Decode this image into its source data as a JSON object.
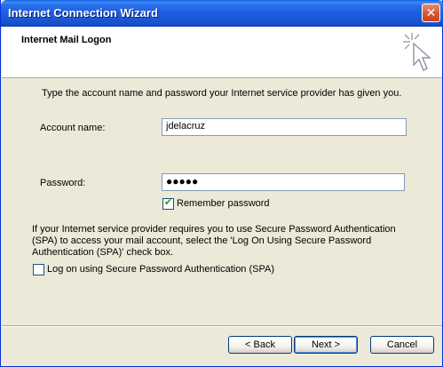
{
  "window": {
    "title": "Internet Connection Wizard",
    "close_glyph": "✕"
  },
  "header": {
    "title": "Internet Mail Logon",
    "icon": "wizard-sparkle-cursor-icon"
  },
  "main": {
    "instructions": "Type the account name and password your Internet service provider has given you.",
    "account_label": "Account name:",
    "account_value": "jdelacruz",
    "password_label": "Password:",
    "password_value": "●●●●●",
    "remember_label": "Remember password",
    "remember_checked": true,
    "spa_paragraph_lines": [
      "If your Internet service provider requires you to use Secure Password Authentication",
      "(SPA) to access your mail account, select the 'Log On Using Secure Password",
      "Authentication (SPA)' check box."
    ],
    "spa_label": "Log on using Secure Password Authentication (SPA)",
    "spa_checked": false
  },
  "footer": {
    "back_label": "< Back",
    "next_label": "Next >",
    "cancel_label": "Cancel"
  }
}
